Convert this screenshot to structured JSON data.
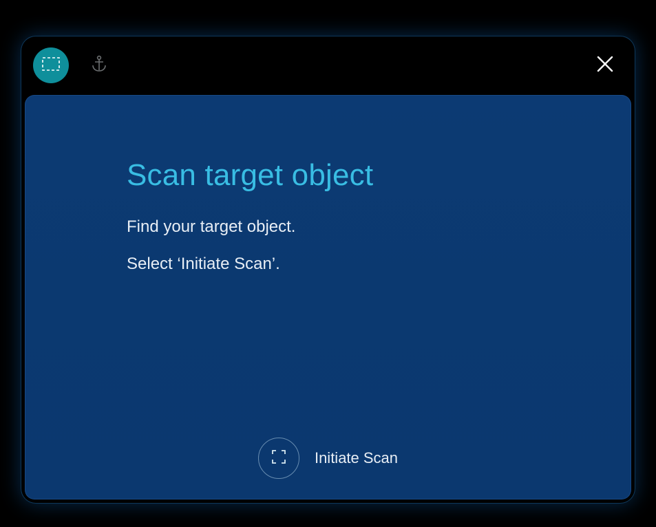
{
  "colors": {
    "accent": "#0f8f9b",
    "title": "#39bde3",
    "panel": "#0b3970",
    "bg": "#000000"
  },
  "titlebar": {
    "mode_icon": "marquee-icon",
    "anchor_icon": "anchor-icon",
    "close_icon": "close-icon"
  },
  "main": {
    "title": "Scan target object",
    "line1": "Find your target object.",
    "line2": "Select ‘Initiate Scan’."
  },
  "footer": {
    "scan_icon": "corners-icon",
    "scan_label": "Initiate Scan"
  }
}
